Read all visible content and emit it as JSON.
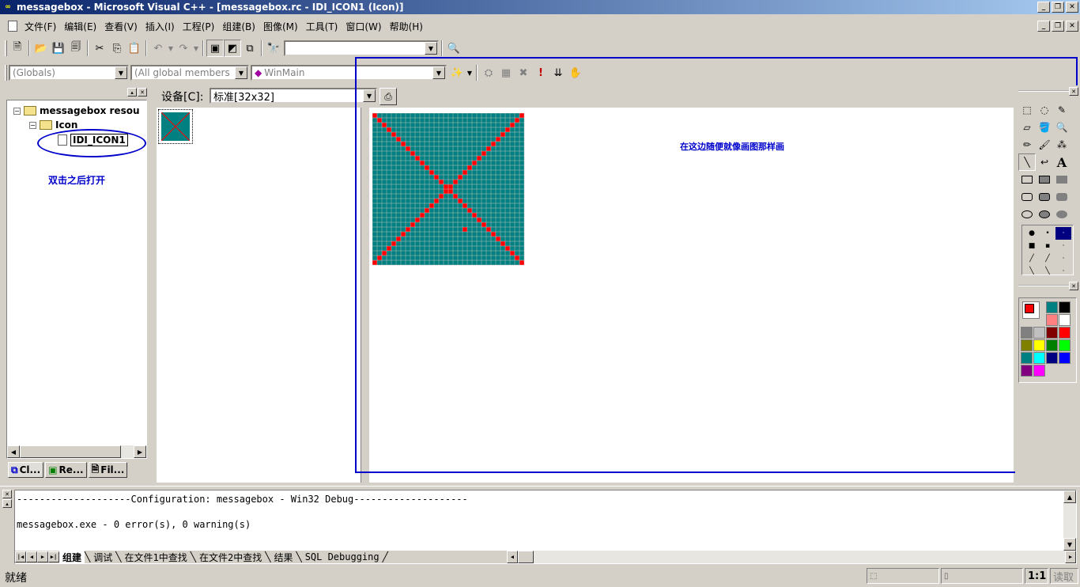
{
  "title": "messagebox - Microsoft Visual C++ - [messagebox.rc - IDI_ICON1 (Icon)]",
  "menu": [
    "文件(F)",
    "编辑(E)",
    "查看(V)",
    "插入(I)",
    "工程(P)",
    "组建(B)",
    "图像(M)",
    "工具(T)",
    "窗口(W)",
    "帮助(H)"
  ],
  "wizard": {
    "scope": "(Globals)",
    "members": "(All global members",
    "function": "WinMain"
  },
  "tree": {
    "root": "messagebox resou",
    "folder": "Icon",
    "item": "IDI_ICON1",
    "annotation": "双击之后打开"
  },
  "tabs": {
    "class": "Cl...",
    "resource": "Re...",
    "file": "Fil..."
  },
  "device": {
    "label": "设备[C]:",
    "value": "标准[32x32]"
  },
  "canvas_note": "在这边随便就像画图那样画",
  "output": {
    "line1": "--------------------Configuration: messagebox - Win32 Debug--------------------",
    "line2": "messagebox.exe - 0 error(s), 0 warning(s)",
    "tabs": [
      "组建",
      "调试",
      "在文件1中查找",
      "在文件2中查找",
      "结果",
      "SQL Debugging"
    ]
  },
  "status": {
    "ready": "就绪",
    "zoom": "1:1",
    "mode": "读取"
  },
  "colors": {
    "teal": "#008080",
    "red": "#ff0000",
    "annotation": "#0000cc"
  }
}
